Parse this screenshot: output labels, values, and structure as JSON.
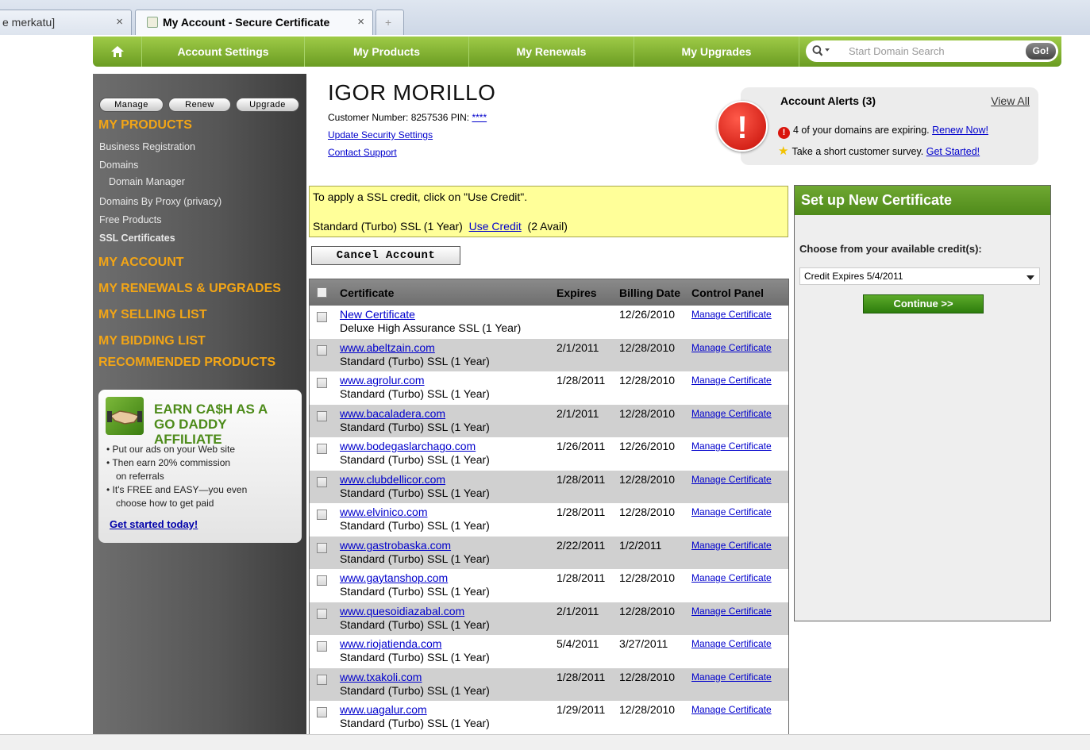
{
  "browser": {
    "tabs": [
      {
        "label": "e merkatu]"
      },
      {
        "label": "My Account - Secure Certificate"
      },
      {
        "label": "+"
      }
    ],
    "close_glyph": "×"
  },
  "nav": {
    "home_icon": "house-icon",
    "items": [
      "Account Settings",
      "My Products",
      "My Renewals",
      "My Upgrades"
    ],
    "search_placeholder": "Start Domain Search",
    "go_label": "Go!"
  },
  "sidebar": {
    "buttons": [
      "Manage",
      "Renew",
      "Upgrade"
    ],
    "my_products": "MY PRODUCTS",
    "product_items": [
      "Business Registration",
      "Domains",
      "Domain Manager",
      "Domains By Proxy (privacy)",
      "Free Products",
      "SSL Certificates"
    ],
    "my_account": "MY ACCOUNT",
    "renewals_upgrades": "MY RENEWALS & UPGRADES",
    "selling_list": "MY SELLING LIST",
    "bidding_list": "MY BIDDING LIST",
    "recommended": "RECOMMENDED PRODUCTS",
    "affiliate": {
      "title_line1": "EARN CA$H AS A",
      "title_line2": "GO DADDY AFFILIATE",
      "bullets": [
        "• Put our ads on your Web site",
        "• Then earn 20% commission",
        "   on referrals",
        "• It's FREE and EASY—you even",
        "   choose how to get paid"
      ],
      "link": "Get started today!"
    }
  },
  "customer": {
    "name": "IGOR MORILLO",
    "number_label": "Customer Number: 8257536   PIN:",
    "pin": "****",
    "security_link": "Update Security Settings",
    "support_link": "Contact Support"
  },
  "alerts": {
    "title": "Account Alerts (3)",
    "view_all": "View All",
    "row1_text": "4 of your domains are expiring.",
    "row1_link": "Renew Now!",
    "row2_text": "Take a short customer survey.",
    "row2_link": "Get Started!"
  },
  "ssl_notice": {
    "line1": "To apply a SSL credit, click on \"Use Credit\".",
    "line2_text": "Standard (Turbo) SSL (1 Year)",
    "line2_link": "Use Credit",
    "line2_avail": "(2 Avail)"
  },
  "cancel_button": "Cancel Account",
  "table": {
    "headers": [
      "Certificate",
      "Expires",
      "Billing Date",
      "Control Panel"
    ],
    "rows": [
      {
        "name": "New Certificate",
        "type": "Deluxe High Assurance SSL (1 Year)",
        "expires": "",
        "billing": "12/26/2010",
        "cp": "Manage Certificate"
      },
      {
        "name": "www.abeltzain.com",
        "type": "Standard (Turbo) SSL (1 Year)",
        "expires": "2/1/2011",
        "billing": "12/28/2010",
        "cp": "Manage Certificate"
      },
      {
        "name": "www.agrolur.com",
        "type": "Standard (Turbo) SSL (1 Year)",
        "expires": "1/28/2011",
        "billing": "12/28/2010",
        "cp": "Manage Certificate"
      },
      {
        "name": "www.bacaladera.com",
        "type": "Standard (Turbo) SSL (1 Year)",
        "expires": "2/1/2011",
        "billing": "12/28/2010",
        "cp": "Manage Certificate"
      },
      {
        "name": "www.bodegaslarchago.com",
        "type": "Standard (Turbo) SSL (1 Year)",
        "expires": "1/26/2011",
        "billing": "12/26/2010",
        "cp": "Manage Certificate"
      },
      {
        "name": "www.clubdellicor.com",
        "type": "Standard (Turbo) SSL (1 Year)",
        "expires": "1/28/2011",
        "billing": "12/28/2010",
        "cp": "Manage Certificate"
      },
      {
        "name": "www.elvinico.com",
        "type": "Standard (Turbo) SSL (1 Year)",
        "expires": "1/28/2011",
        "billing": "12/28/2010",
        "cp": "Manage Certificate"
      },
      {
        "name": "www.gastrobaska.com",
        "type": "Standard (Turbo) SSL (1 Year)",
        "expires": "2/22/2011",
        "billing": "1/2/2011",
        "cp": "Manage Certificate"
      },
      {
        "name": "www.gaytanshop.com",
        "type": "Standard (Turbo) SSL (1 Year)",
        "expires": "1/28/2011",
        "billing": "12/28/2010",
        "cp": "Manage Certificate"
      },
      {
        "name": "www.quesoidiazabal.com",
        "type": "Standard (Turbo) SSL (1 Year)",
        "expires": "2/1/2011",
        "billing": "12/28/2010",
        "cp": "Manage Certificate"
      },
      {
        "name": "www.riojatienda.com",
        "type": "Standard (Turbo) SSL (1 Year)",
        "expires": "5/4/2011",
        "billing": "3/27/2011",
        "cp": "Manage Certificate"
      },
      {
        "name": "www.txakoli.com",
        "type": "Standard (Turbo) SSL (1 Year)",
        "expires": "1/28/2011",
        "billing": "12/28/2010",
        "cp": "Manage Certificate"
      },
      {
        "name": "www.uagalur.com",
        "type": "Standard (Turbo) SSL (1 Year)",
        "expires": "1/29/2011",
        "billing": "12/28/2010",
        "cp": "Manage Certificate"
      }
    ]
  },
  "new_cert": {
    "title": "Set up New Certificate",
    "choose_label": "Choose from your available credit(s):",
    "selected": "Credit Expires 5/4/2011",
    "continue": "Continue >>"
  },
  "colors": {
    "accent_green": "#6a9c22",
    "sidebar_heading": "#f2a516",
    "notice_yellow": "#ffff99"
  }
}
